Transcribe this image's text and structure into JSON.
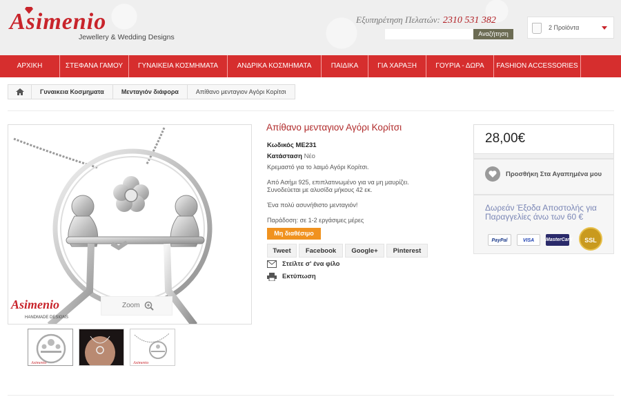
{
  "header": {
    "logo_text": "Asimenio",
    "logo_subtitle": "Jewellery & Wedding Designs",
    "service_label": "Εξυπηρέτηση Πελατών:",
    "service_phone": "2310 531 382",
    "search_placeholder": "",
    "search_button": "Αναζήτηση",
    "cart_label": "2 Προϊόντα"
  },
  "nav": {
    "items": [
      "ΑΡΧΙΚΗ",
      "ΣΤΕΦΑΝΑ ΓΑΜΟΥ",
      "ΓΥΝΑΙΚΕΙΑ ΚΟΣΜΗΜΑΤΑ",
      "ΑΝΔΡΙΚΑ ΚΟΣΜΗΜΑΤΑ",
      "ΠΑΙΔΙΚΑ",
      "ΓΙΑ ΧΑΡΑΞΗ",
      "ΓΟΥΡΙΑ - ΔΩΡΑ",
      "FASHION ACCESSORIES"
    ]
  },
  "breadcrumb": {
    "items": [
      "Γυναικεια Κοσμηματα",
      "Μενταγιόν διάφορα",
      "Απίθανο μενταγιον Αγόρι Κορίτσι"
    ]
  },
  "product": {
    "title": "Απίθανο μενταγιον Αγόρι Κορίτσι",
    "code_label": "Κωδικός",
    "code_value": "ΜΕ231",
    "condition_label": "Κατάσταση",
    "condition_value": "Νέο",
    "short_desc": "Κρεμαστό για το λαιμό Αγόρι Κορίτσι.",
    "desc_line1": "Από Ασήμι 925, επιπλατινωμένο για να μη μαυρίζει.",
    "desc_line2": "Συνοδεύεται με αλυσίδα μήκους 42 εκ.",
    "desc_line3": "Ένα πολύ ασυνήθιστο μενταγιόν!",
    "delivery": "Παράδοση: σε 1-2 εργάσιμες μέρες",
    "availability": "Μη διαθέσιμο",
    "zoom_label": "Zoom",
    "watermark": "Asimenio",
    "watermark_sub": "HANDMADE DESIGNS"
  },
  "social": {
    "tweet": "Tweet",
    "facebook": "Facebook",
    "google": "Google+",
    "pinterest": "Pinterest"
  },
  "actions": {
    "send_friend": "Στείλτε σ' ένα φίλο",
    "print": "Εκτύπωση"
  },
  "sidebar": {
    "price": "28,00€",
    "wishlist": "Προσθήκη Στα Αγαπημένα μου",
    "shipping": "Δωρεάν Έξοδα Αποστολής για Παραγγελίες άνω των 60 €",
    "cards": [
      "PayPal",
      "VISA",
      "MasterCard"
    ],
    "ssl": "SSL"
  },
  "colors": {
    "brand_red": "#d62e2e",
    "title_red": "#b02a2a",
    "availability_orange": "#f0921f"
  }
}
